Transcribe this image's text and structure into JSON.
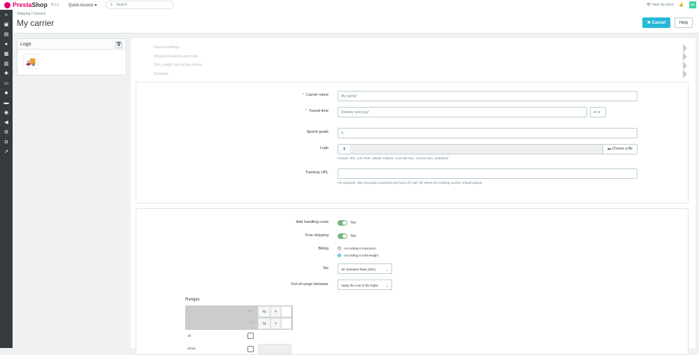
{
  "topbar": {
    "brand_presta": "Presta",
    "brand_shop": "Shop",
    "version": "8.1.x",
    "quick_access": "Quick Access ▾",
    "search_placeholder": "Search",
    "view_store": "View my store"
  },
  "header": {
    "breadcrumb": [
      "Shipping",
      "Carriers"
    ],
    "title": "My carrier",
    "cancel": "Cancel",
    "help": "Help"
  },
  "logo_panel": {
    "title": "Logo"
  },
  "steps": [
    "General settings",
    "Shipping locations and costs",
    "Size, weight, and group access",
    "Summary"
  ],
  "general": {
    "carrier_name": {
      "label": "Carrier name",
      "value": "My carrier"
    },
    "transit_time": {
      "label": "Transit time",
      "value": "Delivery next day!",
      "lang": "en ▾"
    },
    "speed_grade": {
      "label": "Speed grade",
      "value": "0"
    },
    "logo": {
      "label": "Logo",
      "choose": "Choose a file",
      "help": "Format: JPG, GIF, PNG, WEBP. Filesize: 8.00 MB max. Current size: undefined."
    },
    "tracking_url": {
      "label": "Tracking URL",
      "value": "",
      "help": "For example: 'http://example.com/track.php?num=@' with '@' where the tracking number should appear."
    }
  },
  "shipping": {
    "handling": {
      "label": "Add handling costs",
      "value": "Yes"
    },
    "free": {
      "label": "Free shipping",
      "value": "Yes"
    },
    "billing": {
      "label": "Billing",
      "options": [
        "According to total price.",
        "According to total weight."
      ],
      "selected": 1
    },
    "tax": {
      "label": "Tax",
      "value": "SK Standard Rate (20%)"
    },
    "oor": {
      "label": "Out-of-range behavior",
      "value": "Apply the cost of the highe"
    },
    "ranges": {
      "title": "Ranges",
      "ge": ">=",
      "lt": "<",
      "unit": "kg",
      "cur": "€",
      "rows": [
        "All",
        "Africa"
      ]
    }
  },
  "colors": {
    "accent": "#25b9d7",
    "toggle": "#70b580",
    "sidebar": "#363a41",
    "brand": "#df0067"
  }
}
